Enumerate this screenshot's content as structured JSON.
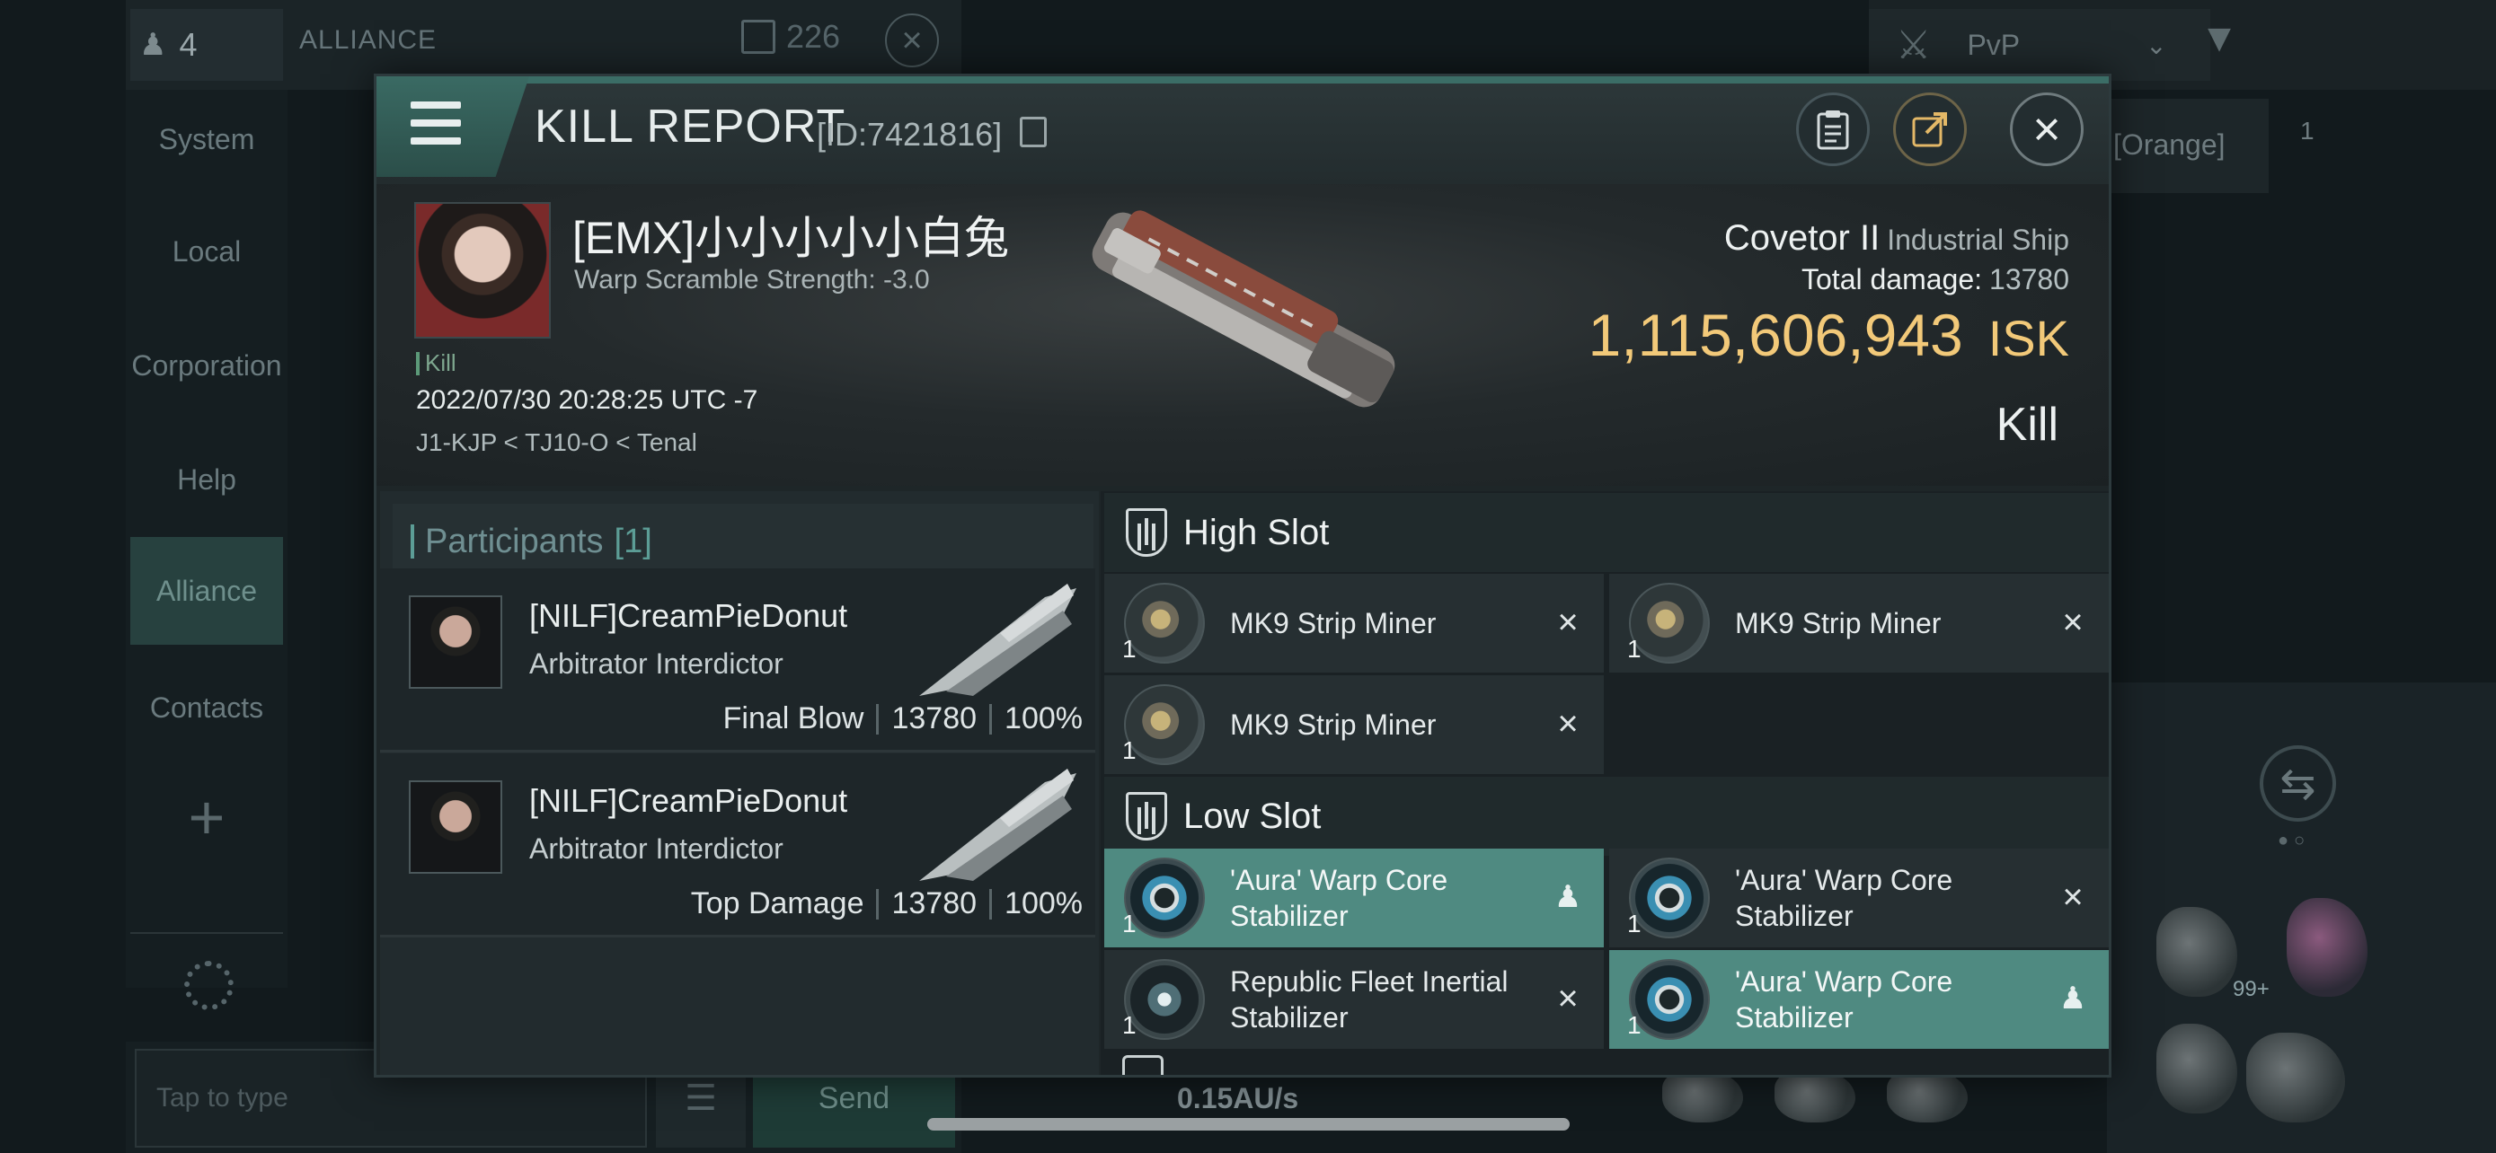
{
  "background": {
    "member_count": "4",
    "channel_label": "ALLIANCE",
    "unread_count": "226",
    "pvp_label": "PvP",
    "orange_label": "[Orange]",
    "small_count": "1",
    "badge": "99+",
    "sidebar": [
      "System",
      "Local",
      "Corporation",
      "Help",
      "Alliance",
      "Contacts"
    ],
    "chat_placeholder": "Tap to type",
    "send_label": "Send",
    "speed": "0.15AU/s"
  },
  "report": {
    "title": "KILL REPORT",
    "id": "[ID:7421816]",
    "victim": {
      "name": "[EMX]小小小小小白兔",
      "warp_scramble": "Warp Scramble Strength: -3.0",
      "tag": "Kill",
      "timestamp": "2022/07/30 20:28:25 UTC -7",
      "location": "J1-KJP < TJ10-O < Tenal"
    },
    "ship": {
      "name": "Covetor II",
      "class": "Industrial Ship",
      "damage_label": "Total damage:",
      "damage_value": "13780",
      "isk_value": "1,115,606,943",
      "isk_unit": "ISK",
      "result": "Kill"
    },
    "participants": {
      "label": "Participants",
      "count": "[1]",
      "rows": [
        {
          "name": "[NILF]CreamPieDonut",
          "ship": "Arbitrator Interdictor",
          "role": "Final Blow",
          "damage": "13780",
          "percent": "100%"
        },
        {
          "name": "[NILF]CreamPieDonut",
          "ship": "Arbitrator Interdictor",
          "role": "Top Damage",
          "damage": "13780",
          "percent": "100%"
        }
      ]
    },
    "high_slot": {
      "label": "High Slot",
      "modules": [
        {
          "qty": "1",
          "name": "MK9 Strip Miner",
          "state": "destroyed"
        },
        {
          "qty": "1",
          "name": "MK9 Strip Miner",
          "state": "destroyed"
        },
        {
          "qty": "1",
          "name": "MK9 Strip Miner",
          "state": "destroyed"
        }
      ]
    },
    "low_slot": {
      "label": "Low Slot",
      "modules": [
        {
          "qty": "1",
          "name": "'Aura' Warp Core Stabilizer",
          "state": "dropped"
        },
        {
          "qty": "1",
          "name": "'Aura' Warp Core Stabilizer",
          "state": "destroyed"
        },
        {
          "qty": "1",
          "name": "Republic Fleet Inertial Stabilizer",
          "state": "destroyed"
        },
        {
          "qty": "1",
          "name": "'Aura' Warp Core Stabilizer",
          "state": "dropped"
        }
      ]
    },
    "colors": {
      "accent": "#4f8a81",
      "isk": "#f2c979",
      "header_bar": "#3b6d66"
    }
  }
}
